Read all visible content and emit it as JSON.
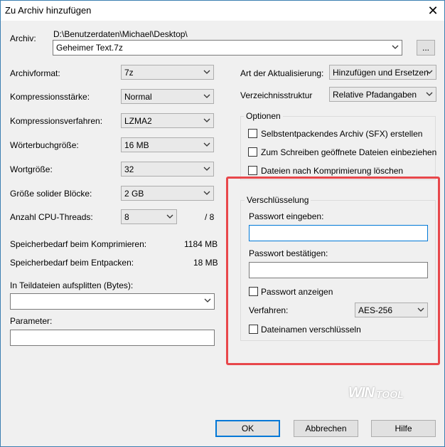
{
  "window": {
    "title": "Zu Archiv hinzufügen",
    "close_glyph": "✕"
  },
  "archive": {
    "label": "Archiv:",
    "path": "D:\\Benutzerdaten\\Michael\\Desktop\\",
    "filename": "Geheimer Text.7z",
    "browse_label": "..."
  },
  "left": {
    "format": {
      "label": "Archivformat:",
      "value": "7z"
    },
    "compression_level": {
      "label": "Kompressionsstärke:",
      "value": "Normal"
    },
    "compression_method": {
      "label": "Kompressionsverfahren:",
      "value": "LZMA2"
    },
    "dictionary_size": {
      "label": "Wörterbuchgröße:",
      "value": "16 MB"
    },
    "word_size": {
      "label": "Wortgröße:",
      "value": "32"
    },
    "solid_block_size": {
      "label": "Größe solider Blöcke:",
      "value": "2 GB"
    },
    "cpu_threads": {
      "label": "Anzahl CPU-Threads:",
      "value": "8",
      "total": "/ 8"
    },
    "memory_compress": {
      "label": "Speicherbedarf beim Komprimieren:",
      "value": "1184 MB"
    },
    "memory_decompress": {
      "label": "Speicherbedarf beim Entpacken:",
      "value": "18 MB"
    },
    "split": {
      "label": "In Teildateien aufsplitten (Bytes):",
      "value": ""
    },
    "parameters": {
      "label": "Parameter:",
      "value": ""
    }
  },
  "right": {
    "update_mode": {
      "label": "Art der Aktualisierung:",
      "value": "Hinzufügen und Ersetzen"
    },
    "path_mode": {
      "label": "Verzeichnisstruktur",
      "value": "Relative Pfadangaben"
    },
    "options": {
      "title": "Optionen",
      "sfx": "Selbstentpackendes Archiv (SFX) erstellen",
      "shared": "Zum Schreiben geöffnete Dateien einbeziehen",
      "delete_after": "Dateien nach Komprimierung löschen"
    },
    "encryption": {
      "title": "Verschlüsselung",
      "password_label": "Passwort eingeben:",
      "confirm_label": "Passwort bestätigen:",
      "show_password": "Passwort anzeigen",
      "method_label": "Verfahren:",
      "method_value": "AES-256",
      "encrypt_names": "Dateinamen verschlüsseln"
    }
  },
  "watermark": {
    "text1": "WIN",
    "text2": "TOOL"
  },
  "buttons": {
    "ok": "OK",
    "cancel": "Abbrechen",
    "help": "Hilfe"
  },
  "colors": {
    "highlight": "#e8474b",
    "focus": "#0078d7"
  }
}
